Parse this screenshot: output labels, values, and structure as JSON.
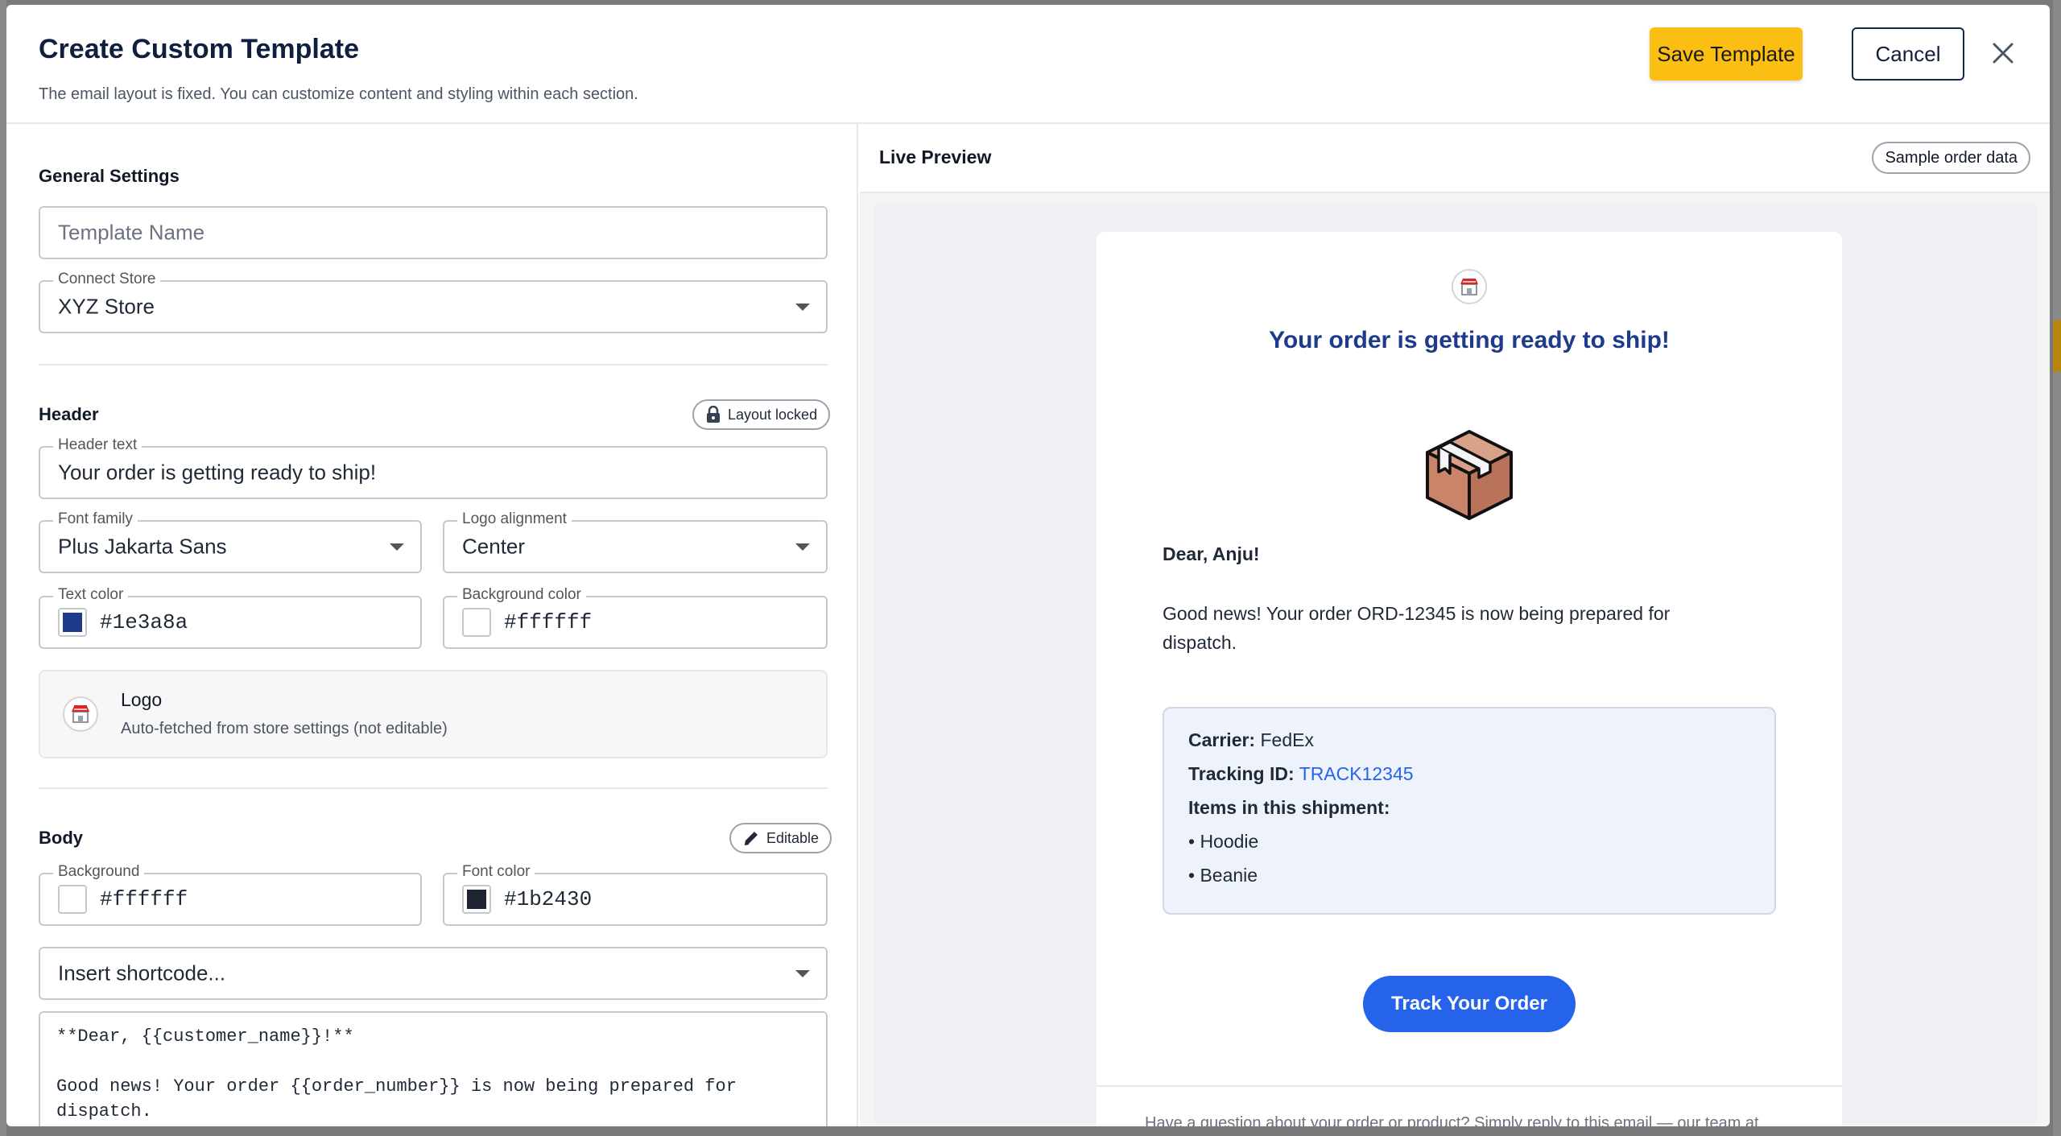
{
  "modal": {
    "title": "Create Custom Template",
    "subtitle": "The email layout is fixed. You can customize content and styling within each section.",
    "save_label": "Save Template",
    "cancel_label": "Cancel"
  },
  "general": {
    "section_title": "General Settings",
    "template_name_placeholder": "Template Name",
    "connect_store_label": "Connect Store",
    "connect_store_value": "XYZ Store"
  },
  "header_section": {
    "section_title": "Header",
    "badge": "Layout locked",
    "header_text_label": "Header text",
    "header_text_value": "Your order is getting ready to ship!",
    "font_family_label": "Font family",
    "font_family_value": "Plus Jakarta Sans",
    "logo_alignment_label": "Logo alignment",
    "logo_alignment_value": "Center",
    "text_color_label": "Text color",
    "text_color_value": "#1e3a8a",
    "bg_color_label": "Background color",
    "bg_color_value": "#ffffff",
    "logo_title": "Logo",
    "logo_subtitle": "Auto-fetched from store settings (not editable)"
  },
  "body_section": {
    "section_title": "Body",
    "badge": "Editable",
    "background_label": "Background",
    "background_value": "#ffffff",
    "font_color_label": "Font color",
    "font_color_value": "#1b2430",
    "shortcode_placeholder": "Insert shortcode...",
    "content": "**Dear, {{customer_name}}!**\n\nGood news! Your order {{order_number}} is now being prepared for\ndispatch."
  },
  "preview": {
    "title": "Live Preview",
    "sample_label": "Sample order data",
    "email_header": "Your order is getting ready to ship!",
    "greeting": "Dear, Anju!",
    "message": "Good news! Your order ORD-12345 is now being prepared for dispatch.",
    "carrier_label": "Carrier:",
    "carrier_value": "FedEx",
    "tracking_label": "Tracking ID:",
    "tracking_value": "TRACK12345",
    "items_label": "Items in this shipment:",
    "items": [
      "• Hoodie",
      "• Beanie"
    ],
    "button_label": "Track Your Order",
    "footer": "Have a question about your order or product? Simply reply to this email — our team at"
  },
  "colors": {
    "accent_yellow": "#fbbf14",
    "header_text": "#1e3a8a",
    "body_font": "#1b2430",
    "link_blue": "#2563eb"
  }
}
